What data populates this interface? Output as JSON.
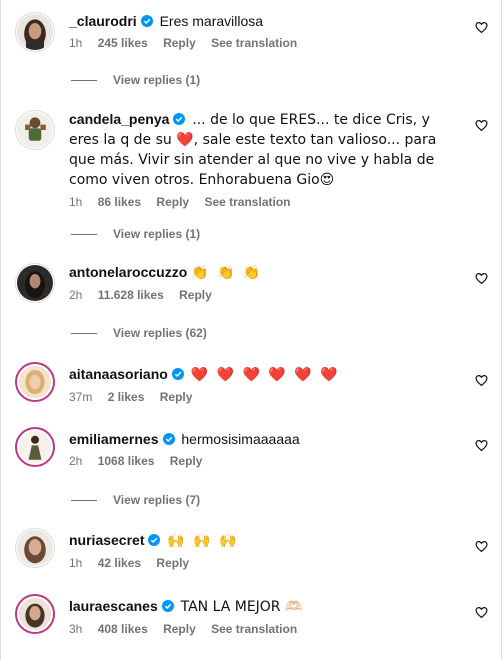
{
  "colors": {
    "meta": "#737373",
    "verified": "#0095f6",
    "heart_emoji": "#e0245e",
    "story_ring": "#c13584"
  },
  "comments": [
    {
      "username": "_claurodri",
      "text": "Eres maravillosa",
      "time": "1h",
      "likes": "245 likes",
      "reply": "Reply",
      "translate": "See translation",
      "replies": "View replies (1)"
    },
    {
      "username": "candela_penya",
      "text": "... de lo que ERES... te dice Cris, y eres la q de su ❤️, sale este texto tan valioso... para que más. Vivir sin atender al que no vive y habla de como viven otros. Enhorabuena Gio😍",
      "time": "1h",
      "likes": "86 likes",
      "reply": "Reply",
      "translate": "See translation",
      "replies": "View replies (1)"
    },
    {
      "username": "antonelaroccuzzo",
      "text": "👏 👏 👏",
      "time": "2h",
      "likes": "11.628 likes",
      "reply": "Reply",
      "replies": "View replies (62)"
    },
    {
      "username": "aitanaasoriano",
      "text": "❤️ ❤️ ❤️ ❤️ ❤️ ❤️",
      "time": "37m",
      "likes": "2 likes",
      "reply": "Reply"
    },
    {
      "username": "emiliamernes",
      "text": "hermosisimaaaaaa",
      "time": "2h",
      "likes": "1068 likes",
      "reply": "Reply",
      "replies": "View replies (7)"
    },
    {
      "username": "nuriasecret",
      "text": "🙌 🙌 🙌",
      "time": "1h",
      "likes": "42 likes",
      "reply": "Reply"
    },
    {
      "username": "lauraescanes",
      "text": "TAN LA MEJOR 🫶🏻",
      "time": "3h",
      "likes": "408 likes",
      "reply": "Reply",
      "translate": "See translation"
    }
  ]
}
